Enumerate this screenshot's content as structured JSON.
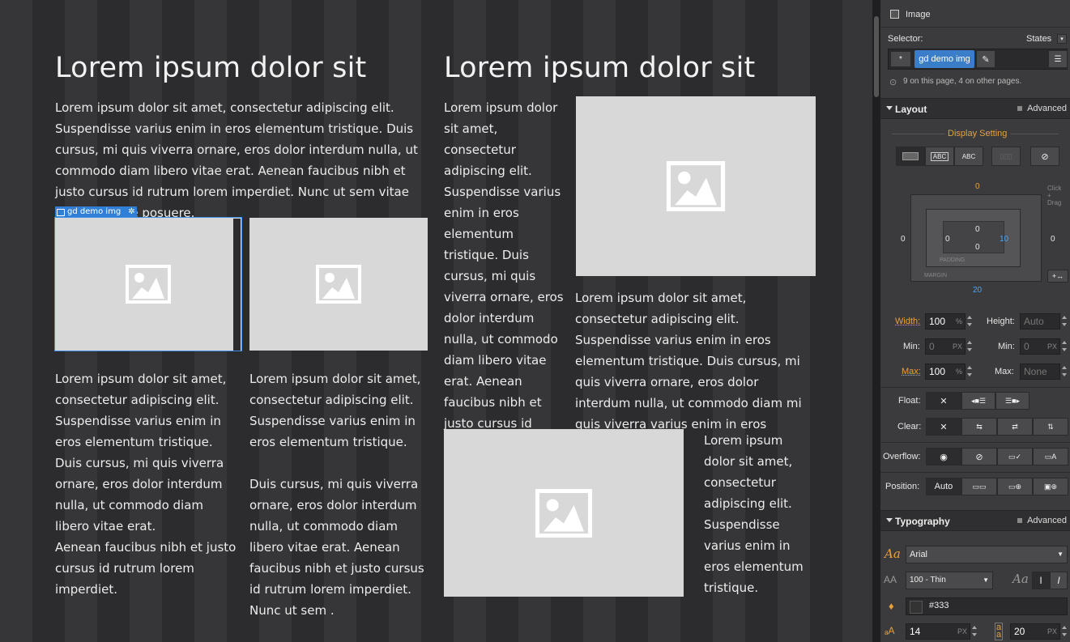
{
  "content": {
    "heading_left": "Lorem ipsum dolor sit",
    "heading_right": "Lorem ipsum dolor sit",
    "intro": "Lorem ipsum dolor sit amet, consectetur adipiscing elit. Suspendisse varius enim in eros elementum tristique. Duis cursus, mi quis viverra ornare, eros dolor interdum nulla, ut commodo diam libero vitae erat. Aenean faucibus nibh et justo cursus id rutrum lorem imperdiet. Nunc ut sem vitae risus tristique posuere.",
    "selected_tag": "gd demo img",
    "col1_p1": "Lorem ipsum dolor sit amet, consectetur adipiscing elit. Suspendisse varius enim in eros elementum tristique. Duis cursus, mi quis viverra ornare, eros dolor interdum nulla, ut commodo diam libero vitae erat.",
    "col1_p2": "Aenean faucibus nibh et justo cursus id rutrum lorem imperdiet.",
    "col2_p1": "Lorem ipsum dolor sit amet, consectetur adipiscing elit. Suspendisse varius enim in eros elementum tristique.",
    "col2_p2": "Duis cursus, mi quis viverra ornare, eros dolor interdum nulla, ut commodo diam libero vitae erat. Aenean faucibus nibh et justo cursus id rutrum lorem imperdiet. Nunc ut sem .",
    "right_narrow": "Lorem ipsum dolor sit amet, consectetur adipiscing elit. Suspendisse varius enim in eros elementum tristique. Duis cursus, mi quis viverra ornare, eros dolor interdum nulla, ut commodo diam libero vitae erat. Aenean faucibus nibh et justo cursus id rutrum lorem imperdiet.",
    "right_under_img": "Lorem ipsum dolor sit amet, consectetur adipiscing elit. Suspendisse varius enim in eros elementum tristique. Duis cursus, mi quis viverra ornare, eros dolor interdum nulla, ut commodo diam mi quis viverra varius enim in eros elementum.",
    "right_bottom": "Lorem ipsum dolor sit amet, consectetur adipiscing elit. Suspendisse varius enim in eros elementum tristique."
  },
  "panel": {
    "element_type": "Image",
    "selector_label": "Selector:",
    "states_label": "States",
    "selector_chip": "gd demo img",
    "usage_text": "9 on this page, 4 on other pages.",
    "layout": {
      "title": "Layout",
      "advanced": "Advanced",
      "display_setting": "Display Setting",
      "display_btn_inline_block": "ABC",
      "display_btn_inline": "ABC",
      "margin_top": "0",
      "margin_left": "0",
      "margin_right": "0",
      "margin_bottom": "20",
      "padding_top": "0",
      "padding_left": "0",
      "padding_right": "10",
      "padding_bottom": "0",
      "padding_label": "PADDING",
      "margin_label": "MARGIN",
      "click_drag": "Click + Drag",
      "width_label": "Width:",
      "width_value": "100",
      "width_unit": "%",
      "height_label": "Height:",
      "height_value": "Auto",
      "min_label": "Min:",
      "min_w_value": "0",
      "min_w_unit": "PX",
      "min_h_value": "0",
      "min_h_unit": "PX",
      "max_label": "Max:",
      "max_w_value": "100",
      "max_w_unit": "%",
      "max_h_label": "Max:",
      "max_h_value": "None",
      "float_label": "Float:",
      "clear_label": "Clear:",
      "overflow_label": "Overflow:",
      "position_label": "Position:",
      "position_auto": "Auto"
    },
    "typography": {
      "title": "Typography",
      "advanced": "Advanced",
      "font_family": "Arial",
      "font_weight": "100 - Thin",
      "color": "#333",
      "font_size": "14",
      "font_size_unit": "PX",
      "line_height": "20",
      "line_height_unit": "PX"
    }
  }
}
